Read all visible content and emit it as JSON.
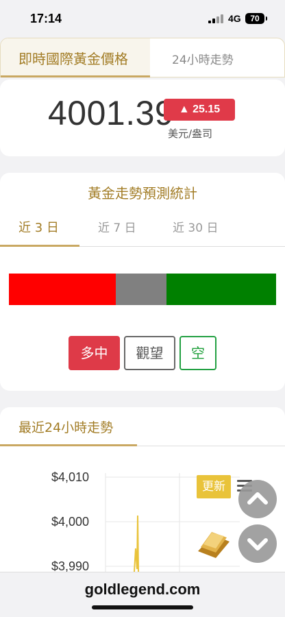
{
  "status_bar": {
    "time": "17:14",
    "network": "4G",
    "battery": "70"
  },
  "price_tabs": {
    "active": "即時國際黃金價格",
    "second": "24小時走勢"
  },
  "price": {
    "value": "4001.39",
    "change": "▲ 25.15",
    "unit": "美元/盎司"
  },
  "forecast": {
    "title": "黃金走勢預測統計",
    "tabs": [
      "近 3 日",
      "近 7 日",
      "近 30 日"
    ],
    "distribution": [
      {
        "label": "多",
        "fraction": 0.4,
        "color": "#ff0000"
      },
      {
        "label": "中",
        "fraction": 0.19,
        "color": "#808080"
      },
      {
        "label": "空",
        "fraction": 0.41,
        "color": "#008000"
      }
    ],
    "buttons": {
      "bull": "多中",
      "watch": "觀望",
      "bear": "空"
    }
  },
  "trend": {
    "title": "最近24小時走勢",
    "y_labels": [
      "$4,010",
      "$4,000",
      "$3,990"
    ],
    "update_label": "更新"
  },
  "footer": {
    "domain": "goldlegend.com"
  },
  "colors": {
    "gold": "#a27c25",
    "bull": "#de3a48",
    "bear": "#22a042"
  }
}
